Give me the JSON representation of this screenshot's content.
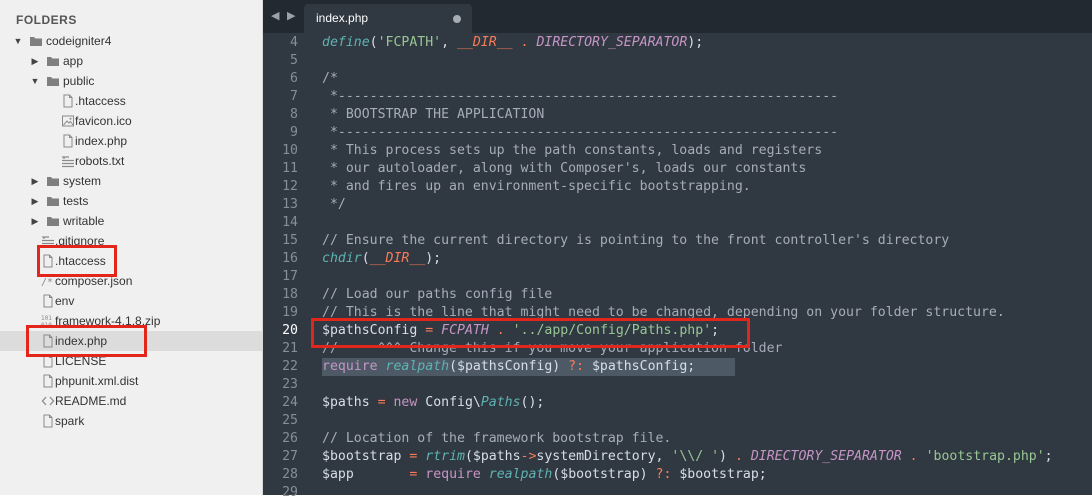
{
  "sidebar": {
    "header": "FOLDERS",
    "items": [
      {
        "label": "codeigniter4",
        "type": "folder",
        "open": true,
        "depth": 0
      },
      {
        "label": "app",
        "type": "folder",
        "open": false,
        "depth": 1
      },
      {
        "label": "public",
        "type": "folder",
        "open": true,
        "depth": 1
      },
      {
        "label": ".htaccess",
        "type": "file",
        "depth": 2
      },
      {
        "label": "favicon.ico",
        "type": "image",
        "depth": 2
      },
      {
        "label": "index.php",
        "type": "file",
        "depth": 2
      },
      {
        "label": "robots.txt",
        "type": "text",
        "depth": 2
      },
      {
        "label": "system",
        "type": "folder",
        "open": false,
        "depth": 1
      },
      {
        "label": "tests",
        "type": "folder",
        "open": false,
        "depth": 1
      },
      {
        "label": "writable",
        "type": "folder",
        "open": false,
        "depth": 1
      },
      {
        "label": ".gitignore",
        "type": "text",
        "depth": 1
      },
      {
        "label": ".htaccess",
        "type": "file",
        "depth": 1
      },
      {
        "label": "composer.json",
        "type": "json",
        "depth": 1
      },
      {
        "label": "env",
        "type": "file",
        "depth": 1
      },
      {
        "label": "framework-4.1.8.zip",
        "type": "binary",
        "depth": 1
      },
      {
        "label": "index.php",
        "type": "file",
        "depth": 1,
        "selected": true
      },
      {
        "label": "LICENSE",
        "type": "file",
        "depth": 1
      },
      {
        "label": "phpunit.xml.dist",
        "type": "file",
        "depth": 1
      },
      {
        "label": "README.md",
        "type": "code",
        "depth": 1
      },
      {
        "label": "spark",
        "type": "file",
        "depth": 1
      }
    ]
  },
  "tab": {
    "label": "index.php",
    "nav": "◀ ▶"
  },
  "code": {
    "active_line": 20,
    "lines": [
      {
        "n": "4",
        "t": [
          [
            "fn",
            "define"
          ],
          [
            "pl",
            "("
          ],
          [
            "str",
            "'FCPATH'"
          ],
          [
            "pl",
            ", "
          ],
          [
            "mc",
            "__DIR__"
          ],
          [
            "pl",
            " "
          ],
          [
            "op",
            "."
          ],
          [
            "pl",
            " "
          ],
          [
            "cst",
            "DIRECTORY_SEPARATOR"
          ],
          [
            "pl",
            ");"
          ]
        ]
      },
      {
        "n": "5",
        "t": []
      },
      {
        "n": "6",
        "t": [
          [
            "cm",
            "/*"
          ]
        ]
      },
      {
        "n": "7",
        "t": [
          [
            "cm",
            " *---------------------------------------------------------------"
          ]
        ]
      },
      {
        "n": "8",
        "t": [
          [
            "cm",
            " * BOOTSTRAP THE APPLICATION"
          ]
        ]
      },
      {
        "n": "9",
        "t": [
          [
            "cm",
            " *---------------------------------------------------------------"
          ]
        ]
      },
      {
        "n": "10",
        "t": [
          [
            "cm",
            " * This process sets up the path constants, loads and registers"
          ]
        ]
      },
      {
        "n": "11",
        "t": [
          [
            "cm",
            " * our autoloader, along with Composer's, loads our constants"
          ]
        ]
      },
      {
        "n": "12",
        "t": [
          [
            "cm",
            " * and fires up an environment-specific bootstrapping."
          ]
        ]
      },
      {
        "n": "13",
        "t": [
          [
            "cm",
            " */"
          ]
        ]
      },
      {
        "n": "14",
        "t": []
      },
      {
        "n": "15",
        "t": [
          [
            "cm",
            "// Ensure the current directory is pointing to the front controller's directory"
          ]
        ]
      },
      {
        "n": "16",
        "t": [
          [
            "fn",
            "chdir"
          ],
          [
            "pl",
            "("
          ],
          [
            "mc",
            "__DIR__"
          ],
          [
            "pl",
            ");"
          ]
        ]
      },
      {
        "n": "17",
        "t": []
      },
      {
        "n": "18",
        "t": [
          [
            "cm",
            "// Load our paths config file"
          ]
        ]
      },
      {
        "n": "19",
        "t": [
          [
            "cm",
            "// This is the line that might need to be changed, depending on your folder structure."
          ]
        ]
      },
      {
        "n": "20",
        "t": [
          [
            "pl",
            "$pathsConfig"
          ],
          [
            "pl",
            " "
          ],
          [
            "op",
            "="
          ],
          [
            "pl",
            " "
          ],
          [
            "cst",
            "FCPATH"
          ],
          [
            "pl",
            " "
          ],
          [
            "op",
            "."
          ],
          [
            "pl",
            " "
          ],
          [
            "str",
            "'../app/Config/Paths.php'"
          ],
          [
            "pl",
            ";"
          ]
        ]
      },
      {
        "n": "21",
        "t": [
          [
            "cm",
            "//     ^^^ Change this if you move your application folder"
          ]
        ]
      },
      {
        "n": "22",
        "t": [
          [
            "kw",
            "require"
          ],
          [
            "pl",
            " "
          ],
          [
            "fn",
            "realpath"
          ],
          [
            "pl",
            "($pathsConfig) "
          ],
          [
            "op",
            "?:"
          ],
          [
            "pl",
            " $pathsConfig;"
          ]
        ]
      },
      {
        "n": "23",
        "t": []
      },
      {
        "n": "24",
        "t": [
          [
            "pl",
            "$paths "
          ],
          [
            "op",
            "="
          ],
          [
            "pl",
            " "
          ],
          [
            "kw",
            "new"
          ],
          [
            "pl",
            " Config\\"
          ],
          [
            "fn",
            "Paths"
          ],
          [
            "pl",
            "();"
          ]
        ]
      },
      {
        "n": "25",
        "t": []
      },
      {
        "n": "26",
        "t": [
          [
            "cm",
            "// Location of the framework bootstrap file."
          ]
        ]
      },
      {
        "n": "27",
        "t": [
          [
            "pl",
            "$bootstrap "
          ],
          [
            "op",
            "="
          ],
          [
            "pl",
            " "
          ],
          [
            "fn",
            "rtrim"
          ],
          [
            "pl",
            "($paths"
          ],
          [
            "op",
            "->"
          ],
          [
            "pl",
            "systemDirectory, "
          ],
          [
            "str",
            "'\\\\/ '"
          ],
          [
            "pl",
            ") "
          ],
          [
            "op",
            "."
          ],
          [
            "pl",
            " "
          ],
          [
            "cst",
            "DIRECTORY_SEPARATOR"
          ],
          [
            "pl",
            " "
          ],
          [
            "op",
            "."
          ],
          [
            "pl",
            " "
          ],
          [
            "str",
            "'bootstrap.php'"
          ],
          [
            "pl",
            ";"
          ]
        ]
      },
      {
        "n": "28",
        "t": [
          [
            "pl",
            "$app       "
          ],
          [
            "op",
            "="
          ],
          [
            "pl",
            " "
          ],
          [
            "kw",
            "require"
          ],
          [
            "pl",
            " "
          ],
          [
            "fn",
            "realpath"
          ],
          [
            "pl",
            "($bootstrap) "
          ],
          [
            "op",
            "?:"
          ],
          [
            "pl",
            " $bootstrap;"
          ]
        ]
      },
      {
        "n": "29",
        "t": []
      }
    ]
  },
  "colors": {
    "editor_bg": "#303841",
    "tabbar_bg": "#232931",
    "sidebar_bg": "#f0f0f0",
    "annotation": "#e2261c"
  }
}
